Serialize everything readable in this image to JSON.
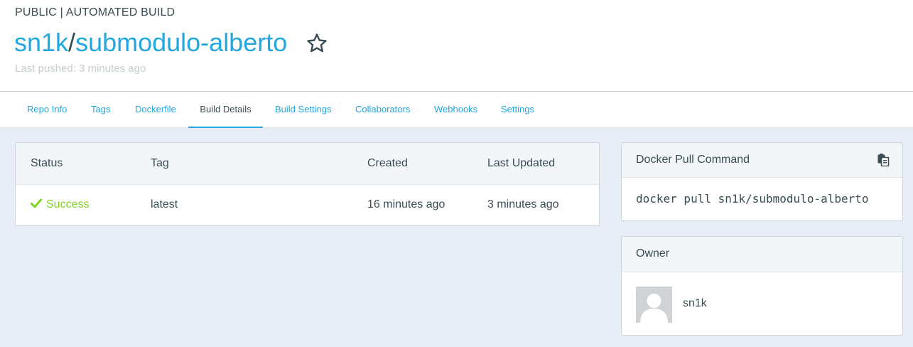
{
  "header": {
    "repo_kind": "PUBLIC | AUTOMATED BUILD",
    "namespace": "sn1k",
    "separator": "/",
    "repo_name": "submodulo-alberto",
    "last_pushed": "Last pushed: 3 minutes ago",
    "star_icon": "star-outline-icon"
  },
  "tabs": [
    {
      "label": "Repo Info",
      "active": false
    },
    {
      "label": "Tags",
      "active": false
    },
    {
      "label": "Dockerfile",
      "active": false
    },
    {
      "label": "Build Details",
      "active": true
    },
    {
      "label": "Build Settings",
      "active": false
    },
    {
      "label": "Collaborators",
      "active": false
    },
    {
      "label": "Webhooks",
      "active": false
    },
    {
      "label": "Settings",
      "active": false
    }
  ],
  "builds": {
    "columns": [
      "Status",
      "Tag",
      "Created",
      "Last Updated"
    ],
    "rows": [
      {
        "status": "Success",
        "status_icon": "check-icon",
        "tag": "latest",
        "created": "16 minutes ago",
        "last_updated": "3 minutes ago"
      }
    ]
  },
  "pull": {
    "title": "Docker Pull Command",
    "command": "docker pull sn1k/submodulo-alberto",
    "copy_icon": "clipboard-icon"
  },
  "owner": {
    "title": "Owner",
    "name": "sn1k",
    "avatar_icon": "default-user-avatar"
  },
  "colors": {
    "link": "#22a8e0",
    "text": "#394d54",
    "success": "#7ed321",
    "background": "#e6edf4",
    "muted": "#c4cdd1"
  }
}
